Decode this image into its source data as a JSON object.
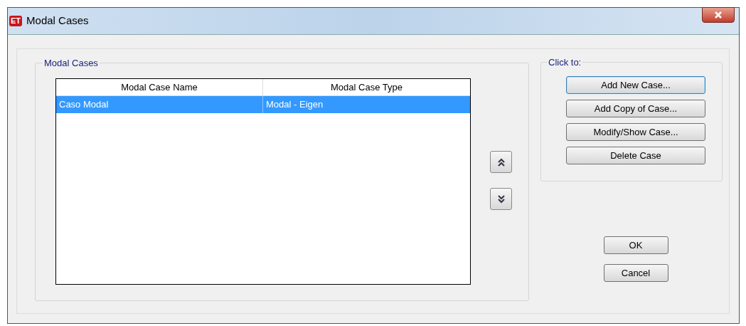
{
  "window": {
    "app_badge": "ET",
    "title": "Modal Cases"
  },
  "modal_cases": {
    "legend": "Modal Cases",
    "table": {
      "columns": [
        "Modal Case Name",
        "Modal Case Type"
      ],
      "rows": [
        {
          "cells": [
            "Caso Modal",
            "Modal - Eigen"
          ],
          "selected": true
        }
      ]
    }
  },
  "click_to": {
    "legend": "Click to:",
    "buttons": [
      {
        "label": "Add New Case...",
        "focused": true
      },
      {
        "label": "Add Copy of Case...",
        "focused": false
      },
      {
        "label": "Modify/Show Case...",
        "focused": false
      },
      {
        "label": "Delete Case",
        "focused": false
      }
    ]
  },
  "buttons": [
    "OK",
    "Cancel"
  ]
}
